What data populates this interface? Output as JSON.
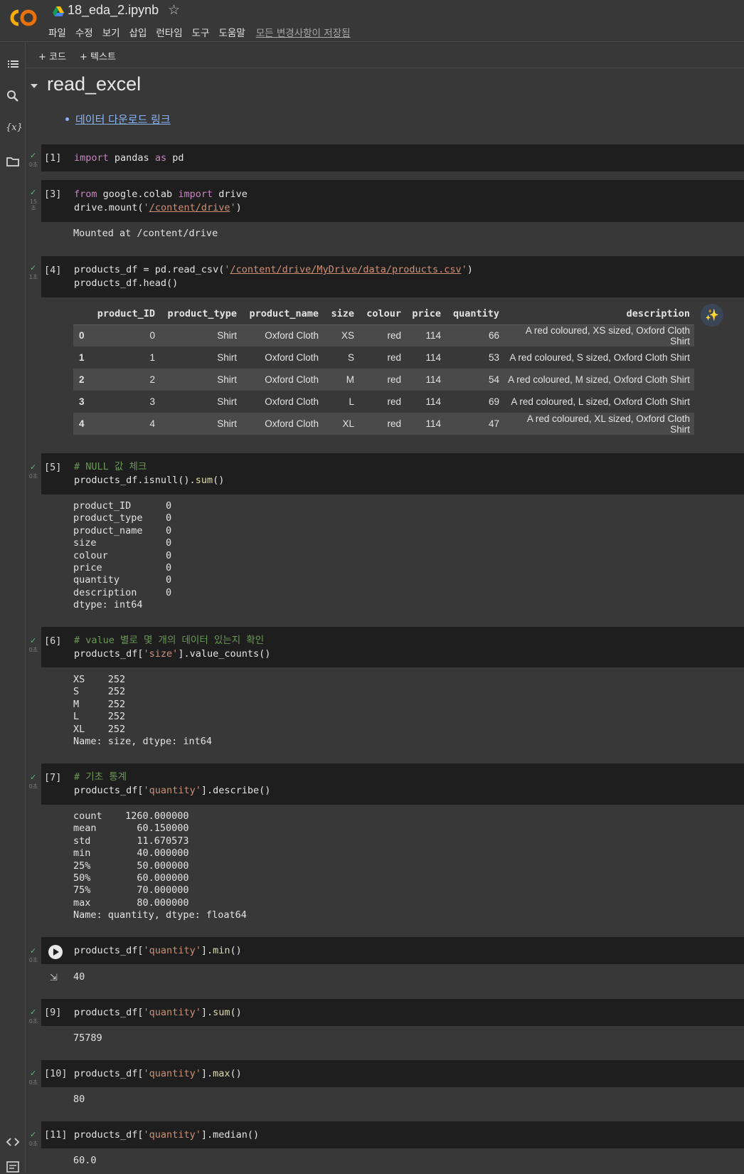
{
  "app": {
    "title": "18_eda_2.ipynb",
    "menu": [
      "파일",
      "수정",
      "보기",
      "삽입",
      "런타임",
      "도구",
      "도움말"
    ],
    "saved_status": "모든 변경사항이 저장됨"
  },
  "toolbar": {
    "add_code": "+ 코드",
    "add_text": "+ 텍스트"
  },
  "sidebar": {
    "icons": [
      "toc-icon",
      "search-icon",
      "variables-icon",
      "folder-icon",
      "code-snippets-icon",
      "terminal-icon"
    ],
    "variables_glyph": "{x}"
  },
  "section": {
    "heading": "read_excel",
    "link": "데이터 다운로드 링크"
  },
  "cells": {
    "c1": {
      "exec": "[1]",
      "time": "0초"
    },
    "c3": {
      "exec": "[3]",
      "time": "15\n초",
      "output": "Mounted at /content/drive"
    },
    "c4": {
      "exec": "[4]",
      "time": "1초"
    },
    "c5": {
      "exec": "[5]",
      "time": "0초",
      "comment": "# NULL 값 체크",
      "output": "product_ID      0\nproduct_type    0\nproduct_name    0\nsize            0\ncolour          0\nprice           0\nquantity        0\ndescription     0\ndtype: int64"
    },
    "c6": {
      "exec": "[6]",
      "time": "0초",
      "comment": "# value 별로 몇 개의 데이터 있는지 확인",
      "output": "XS    252\nS     252\nM     252\nL     252\nXL    252\nName: size, dtype: int64"
    },
    "c7": {
      "exec": "[7]",
      "time": "0초",
      "comment": "# 기초 통계",
      "output": "count    1260.000000\nmean       60.150000\nstd        11.670573\nmin        40.000000\n25%        50.000000\n50%        60.000000\n75%        70.000000\nmax        80.000000\nName: quantity, dtype: float64"
    },
    "c8": {
      "time": "0초",
      "output": "40"
    },
    "c9": {
      "exec": "[9]",
      "time": "0초",
      "output": "75789"
    },
    "c10": {
      "exec": "[10]",
      "time": "0초",
      "output": "80"
    },
    "c11": {
      "exec": "[11]",
      "time": "0초",
      "output": "60.0"
    }
  },
  "dataframe": {
    "columns": [
      "",
      "product_ID",
      "product_type",
      "product_name",
      "size",
      "colour",
      "price",
      "quantity",
      "description"
    ],
    "rows": [
      [
        "0",
        "0",
        "Shirt",
        "Oxford Cloth",
        "XS",
        "red",
        "114",
        "66",
        "A red coloured, XS sized, Oxford Cloth Shirt"
      ],
      [
        "1",
        "1",
        "Shirt",
        "Oxford Cloth",
        "S",
        "red",
        "114",
        "53",
        "A red coloured, S sized, Oxford Cloth Shirt"
      ],
      [
        "2",
        "2",
        "Shirt",
        "Oxford Cloth",
        "M",
        "red",
        "114",
        "54",
        "A red coloured, M sized, Oxford Cloth Shirt"
      ],
      [
        "3",
        "3",
        "Shirt",
        "Oxford Cloth",
        "L",
        "red",
        "114",
        "69",
        "A red coloured, L sized, Oxford Cloth Shirt"
      ],
      [
        "4",
        "4",
        "Shirt",
        "Oxford Cloth",
        "XL",
        "red",
        "114",
        "47",
        "A red coloured, XL sized, Oxford Cloth Shirt"
      ]
    ]
  },
  "colors": {
    "background": "#383838",
    "cell_bg": "#1e1e1e",
    "keyword": "#c586c0",
    "string": "#ce9178",
    "function": "#dcdcaa",
    "comment": "#6a9955",
    "check": "#5fb878",
    "link": "#8ab4f8"
  }
}
